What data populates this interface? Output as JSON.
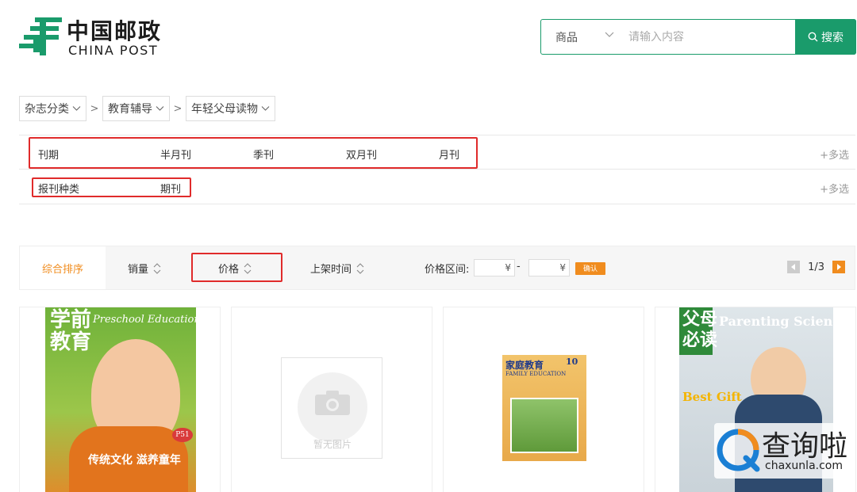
{
  "brand": {
    "name_cn": "中国邮政",
    "name_en": "CHINA POST",
    "color": "#1a9b6b"
  },
  "search": {
    "category": "商品",
    "placeholder": "请输入内容",
    "button_label": "搜索"
  },
  "breadcrumb": [
    {
      "label": "杂志分类"
    },
    {
      "label": "教育辅导"
    },
    {
      "label": "年轻父母读物"
    }
  ],
  "filters": [
    {
      "label": "刊期",
      "options": [
        "半月刊",
        "季刊",
        "双月刊",
        "月刊"
      ],
      "more": "+多选"
    },
    {
      "label": "报刊种类",
      "options": [
        "期刊"
      ],
      "more": "+多选"
    }
  ],
  "sort": {
    "active": "综合排序",
    "sales": "销量",
    "price": "价格",
    "listed": "上架时间",
    "price_range_label": "价格区间:",
    "currency": "¥",
    "dash": "-",
    "confirm": "确认",
    "page": "1/3"
  },
  "products": [
    {
      "name": "学前教育",
      "cover_title": "学前\n教育",
      "cover_subtitle": "Preschool Education",
      "cover_caption": "传统文化 滋养童年",
      "badge": "P51"
    },
    {
      "name": "no-image",
      "placeholder_text": "暂无图片"
    },
    {
      "name": "家庭教育",
      "cover_title": "家庭教育",
      "cover_subtitle": "FAMILY EDUCATION",
      "issue": "10"
    },
    {
      "name": "父母必读",
      "cover_title": "父母\n必读",
      "cover_subtitle": "Parenting Science",
      "cover_caption": "Best Gift"
    }
  ],
  "watermark": {
    "name_cn": "查询啦",
    "domain": "chaxunla.com"
  },
  "colors": {
    "accent_orange": "#f08c1e",
    "highlight_red": "#e02b2b"
  }
}
